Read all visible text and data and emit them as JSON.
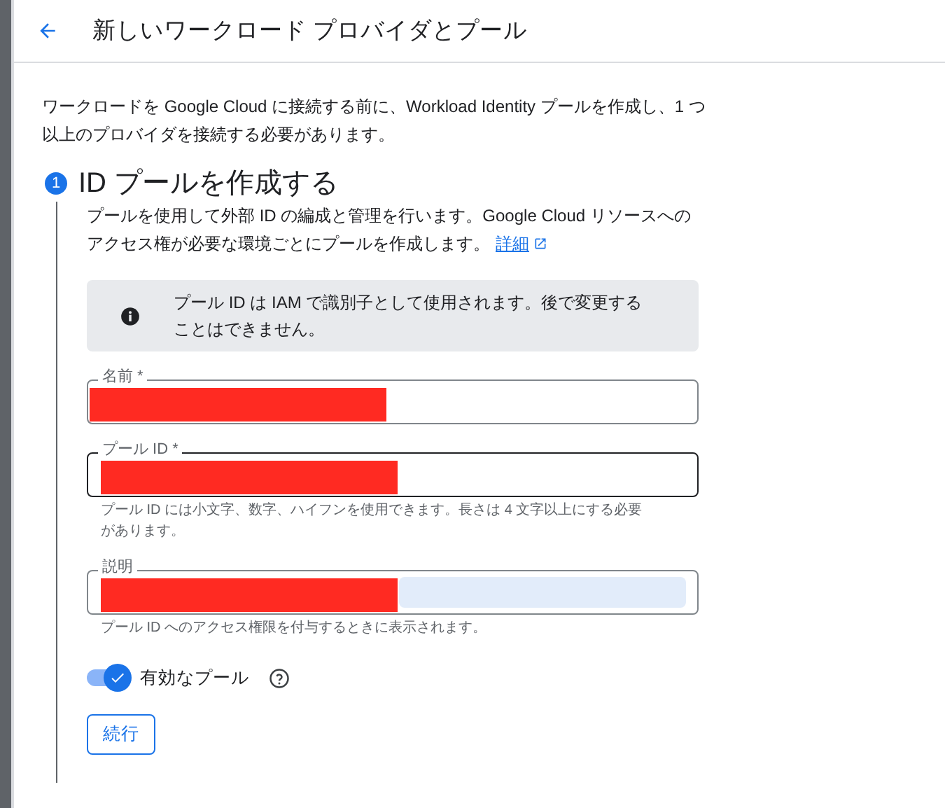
{
  "header": {
    "title": "新しいワークロード プロバイダとプール"
  },
  "intro": "ワークロードを Google Cloud に接続する前に、Workload Identity プールを作成し、1 つ以上のプロバイダを接続する必要があります。",
  "step": {
    "number": "1",
    "title": "ID プールを作成する",
    "description": "プールを使用して外部 ID の編成と管理を行います。Google Cloud リソースへのアクセス権が必要な環境ごとにプールを作成します。",
    "link": "詳細"
  },
  "info": "プール ID は IAM で識別子として使用されます。後で変更することはできません。",
  "fields": [
    {
      "label": "名前 *",
      "focused": false,
      "redacted": true
    },
    {
      "label": "プール ID *",
      "focused": true,
      "redacted": true,
      "hint": "プール ID には小文字、数字、ハイフンを使用できます。長さは 4 文字以上にする必要があります。"
    },
    {
      "label": "説明",
      "focused": false,
      "redacted": true,
      "hint": "プール ID へのアクセス権限を付与するときに表示されます。"
    }
  ],
  "toggle": {
    "label": "有効なプール",
    "on": true
  },
  "button": "続行"
}
